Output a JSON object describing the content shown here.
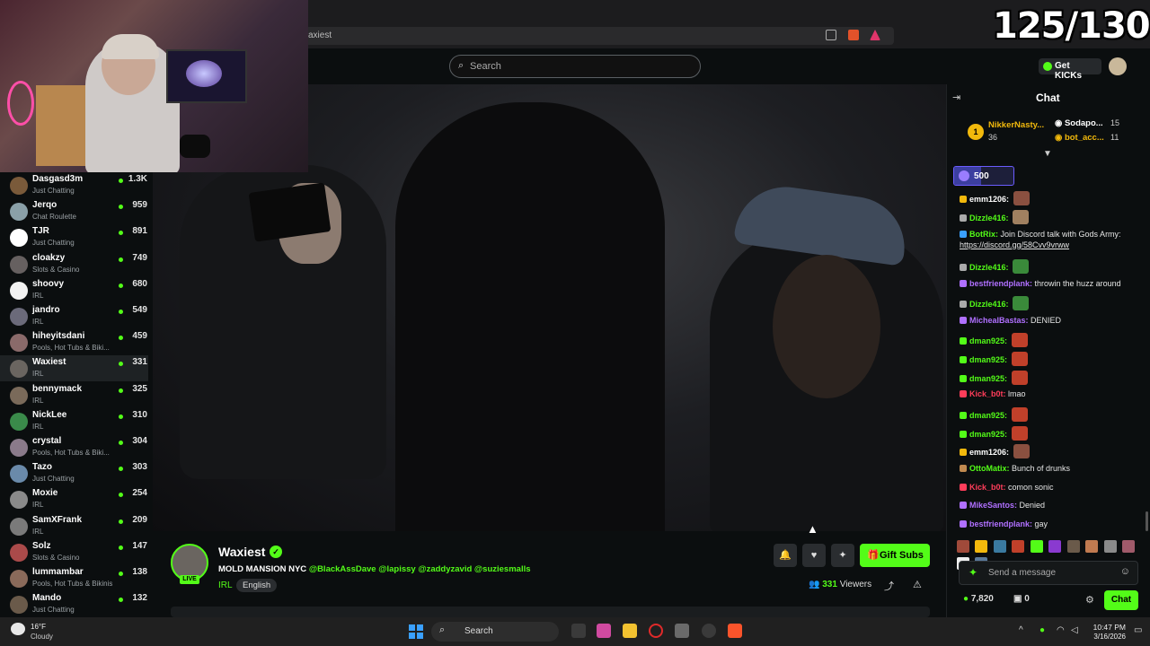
{
  "browser": {
    "url": "axiest"
  },
  "header": {
    "search_placeholder": "Search",
    "get_kicks": "Get KICKs"
  },
  "overlay": {
    "counter": "125/130"
  },
  "sidebar": {
    "channels": [
      {
        "name": "Dasgasd3m",
        "category": "Just Chatting",
        "viewers": "1.3K",
        "color": "#7a5a3a"
      },
      {
        "name": "Jerqo",
        "category": "Chat Roulette",
        "viewers": "959",
        "color": "#8aa0a8"
      },
      {
        "name": "TJR",
        "category": "Just Chatting",
        "viewers": "891",
        "color": "#ffffff"
      },
      {
        "name": "cloakzy",
        "category": "Slots & Casino",
        "viewers": "749",
        "color": "#666060"
      },
      {
        "name": "shoovy",
        "category": "IRL",
        "viewers": "680",
        "color": "#f2f2f2"
      },
      {
        "name": "jandro",
        "category": "IRL",
        "viewers": "549",
        "color": "#6b6a7a"
      },
      {
        "name": "hiheyitsdani",
        "category": "Pools, Hot Tubs & Biki...",
        "viewers": "459",
        "color": "#8a6a6a"
      },
      {
        "name": "Waxiest",
        "category": "IRL",
        "viewers": "331",
        "color": "#6a6560"
      },
      {
        "name": "bennymack",
        "category": "IRL",
        "viewers": "325",
        "color": "#7a6a5a"
      },
      {
        "name": "NickLee",
        "category": "IRL",
        "viewers": "310",
        "color": "#3a8a4a"
      },
      {
        "name": "crystal",
        "category": "Pools, Hot Tubs & Biki...",
        "viewers": "304",
        "color": "#8a7a8a"
      },
      {
        "name": "Tazo",
        "category": "Just Chatting",
        "viewers": "303",
        "color": "#6a8aaa"
      },
      {
        "name": "Moxie",
        "category": "IRL",
        "viewers": "254",
        "color": "#8a8a8a"
      },
      {
        "name": "SamXFrank",
        "category": "IRL",
        "viewers": "209",
        "color": "#7a7a7a"
      },
      {
        "name": "Solz",
        "category": "Slots & Casino",
        "viewers": "147",
        "color": "#aa4a4a"
      },
      {
        "name": "lummambar",
        "category": "Pools, Hot Tubs & Bikinis",
        "viewers": "138",
        "color": "#8a6a5a"
      },
      {
        "name": "Mando",
        "category": "Just Chatting",
        "viewers": "132",
        "color": "#6a5a4a"
      }
    ]
  },
  "stream": {
    "live_label": "LIVE",
    "streamer": "Waxiest",
    "title": "MOLD MANSION NYC",
    "tags": "@BlackAssDave @lapissy @zaddyzavid @suziesmalls",
    "category": "IRL",
    "language": "English",
    "gift_subs": "Gift Subs",
    "viewer_count": "331",
    "viewers_label": "Viewers"
  },
  "chat": {
    "title": "Chat",
    "leaderboard": [
      {
        "rank": "1",
        "name": "NikkerNasty...",
        "count": "36"
      },
      {
        "name": "Sodapo...",
        "count": "15"
      },
      {
        "name": "bot_acc...",
        "count": "11"
      }
    ],
    "pinned_amount": "500",
    "messages": [
      {
        "user": "emm1206:",
        "text": "",
        "color": "#ffffff",
        "emote": "#8a5040"
      },
      {
        "user": "Dizzle416:",
        "text": "",
        "color": "#53fc18",
        "emote": "#a08060"
      },
      {
        "user": "BotRix:",
        "text": "Join Discord talk with Gods Army:",
        "link": "https://discord.gg/58Cvv9vrww",
        "color": "#53fc18",
        "emote": ""
      },
      {
        "user": "Dizzle416:",
        "text": "",
        "color": "#53fc18",
        "emote": "#3a8a3a"
      },
      {
        "user": "bestfriendplank:",
        "text": "throwin the huzz around",
        "color": "#b070ff",
        "emote": ""
      },
      {
        "user": "Dizzle416:",
        "text": "",
        "color": "#53fc18",
        "emote": "#3a8a3a"
      },
      {
        "user": "MichealBastas:",
        "text": "DENIED",
        "color": "#b070ff",
        "emote": ""
      },
      {
        "user": "dman925:",
        "text": "",
        "color": "#53fc18",
        "emote": "#c0402a"
      },
      {
        "user": "dman925:",
        "text": "",
        "color": "#53fc18",
        "emote": "#c0402a"
      },
      {
        "user": "dman925:",
        "text": "",
        "color": "#53fc18",
        "emote": "#c0402a"
      },
      {
        "user": "Kick_b0t:",
        "text": "lmao",
        "color": "#ff3d5a",
        "emote": ""
      },
      {
        "user": "dman925:",
        "text": "",
        "color": "#53fc18",
        "emote": "#c0402a"
      },
      {
        "user": "dman925:",
        "text": "",
        "color": "#53fc18",
        "emote": "#c0402a"
      },
      {
        "user": "emm1206:",
        "text": "",
        "color": "#ffffff",
        "emote": "#8a5040"
      },
      {
        "user": "OttoMatix:",
        "text": "Bunch of drunks",
        "color": "#53fc18",
        "emote": ""
      },
      {
        "user": "Kick_b0t:",
        "text": "comon sonic",
        "color": "#ff3d5a",
        "emote": ""
      },
      {
        "user": "MikeSantos:",
        "text": "Denied",
        "color": "#b070ff",
        "emote": ""
      },
      {
        "user": "bestfriendplank:",
        "text": "gay",
        "color": "#b070ff",
        "emote": ""
      }
    ],
    "input_placeholder": "Send a message",
    "kicks_balance": "7,820",
    "sub_balance": "0",
    "send_label": "Chat"
  },
  "taskbar": {
    "temperature": "16°F",
    "weather": "Cloudy",
    "search_label": "Search",
    "time": "10:47 PM",
    "date": "3/16/2026"
  },
  "colors": {
    "accent": "#53fc18",
    "background": "#0b0e0f"
  }
}
